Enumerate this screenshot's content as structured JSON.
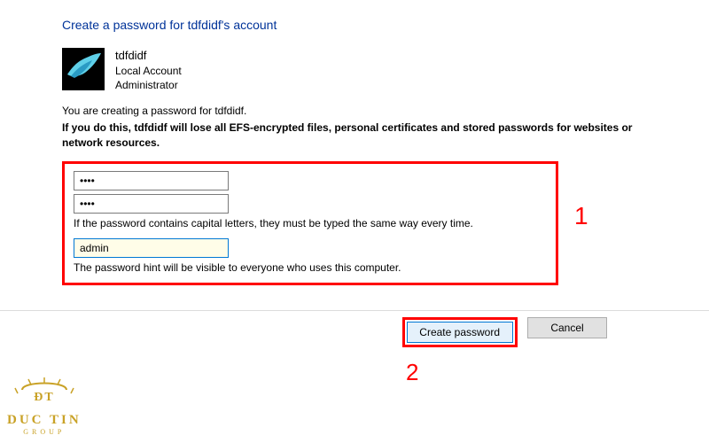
{
  "page": {
    "title": "Create a password for tdfdidf's account"
  },
  "user": {
    "name": "tdfdidf",
    "account_type": "Local Account",
    "role": "Administrator"
  },
  "intro": "You are creating a password for tdfdidf.",
  "warning": "If you do this, tdfdidf will lose all EFS-encrypted files, personal certificates and stored passwords for websites or network resources.",
  "form": {
    "password_value": "••••",
    "confirm_value": "••••",
    "caps_note": "If the password contains capital letters, they must be typed the same way every time.",
    "hint_value": "admin",
    "hint_note": "The password hint will be visible to everyone who uses this computer."
  },
  "callouts": {
    "one": "1",
    "two": "2"
  },
  "buttons": {
    "create": "Create password",
    "cancel": "Cancel"
  },
  "watermark": {
    "name": "DUC TIN",
    "sub": "GROUP"
  }
}
